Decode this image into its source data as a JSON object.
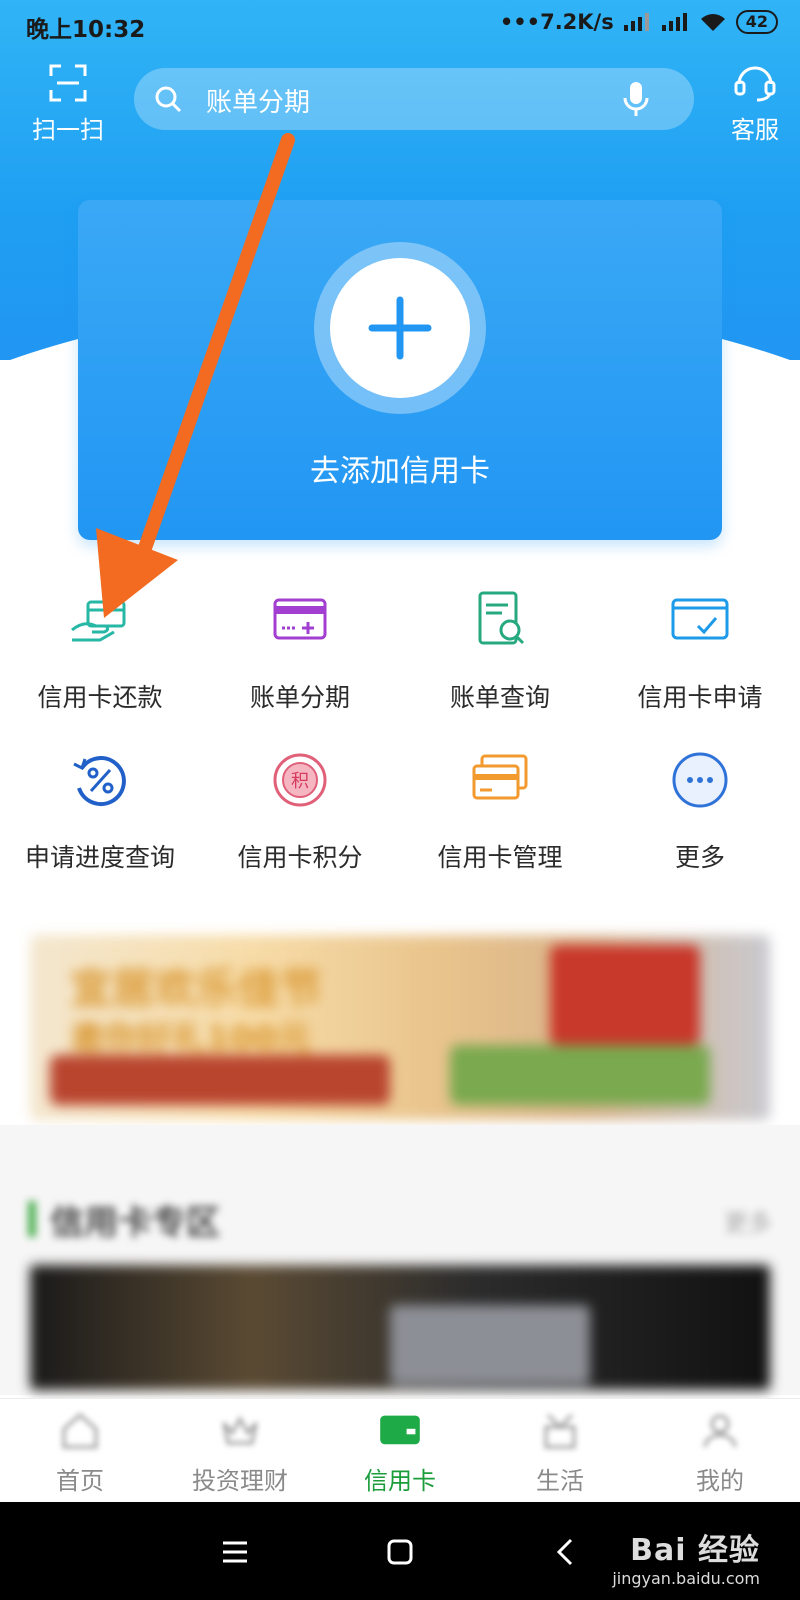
{
  "status_bar": {
    "time": "晚上10:32",
    "net_speed": "•••7.2K/s",
    "battery": "42"
  },
  "top_bar": {
    "scan_label": "扫一扫",
    "search_placeholder": "账单分期",
    "service_label": "客服"
  },
  "add_card": {
    "label": "去添加信用卡"
  },
  "functions": [
    {
      "label": "信用卡还款",
      "icon": "card-hand-icon"
    },
    {
      "label": "账单分期",
      "icon": "installment-card-icon"
    },
    {
      "label": "账单查询",
      "icon": "bill-search-icon"
    },
    {
      "label": "信用卡申请",
      "icon": "card-apply-icon"
    },
    {
      "label": "申请进度查询",
      "icon": "percent-progress-icon"
    },
    {
      "label": "信用卡积分",
      "icon": "points-icon"
    },
    {
      "label": "信用卡管理",
      "icon": "card-manage-icon"
    },
    {
      "label": "更多",
      "icon": "more-icon"
    }
  ],
  "banner": {
    "line1": "宜居欢乐佳节",
    "line2": "邀你好礼100元"
  },
  "zone": {
    "title": "信用卡专区",
    "more": "更多"
  },
  "tabbar": [
    {
      "label": "首页",
      "active": false
    },
    {
      "label": "投资理财",
      "active": false
    },
    {
      "label": "信用卡",
      "active": true
    },
    {
      "label": "生活",
      "active": false
    },
    {
      "label": "我的",
      "active": false
    }
  ],
  "watermark": {
    "main": "Bai 经验",
    "sub": "jingyan.baidu.com"
  },
  "colors": {
    "accent": "#2196f3",
    "active_tab": "#1c9d3c",
    "annotation_arrow": "#f26b21"
  }
}
